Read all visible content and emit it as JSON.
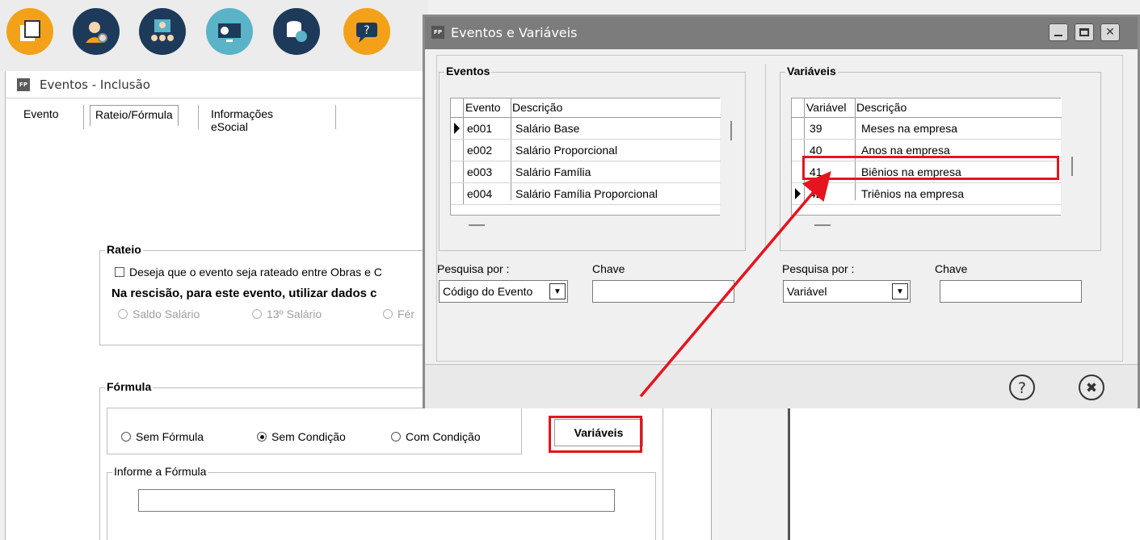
{
  "toolbar": {
    "icons": [
      {
        "name": "documents-icon",
        "color": "#f4a11a"
      },
      {
        "name": "support-gear-icon",
        "color": "#1e3a5a"
      },
      {
        "name": "users-group-icon",
        "color": "#1e3a5a"
      },
      {
        "name": "screen-transfer-icon",
        "color": "#5bb3c7"
      },
      {
        "name": "database-backup-icon",
        "color": "#1e3a5a"
      },
      {
        "name": "help-chat-icon",
        "color": "#f4a11a"
      }
    ]
  },
  "background_window": {
    "app_badge": "FP",
    "title": "Eventos - Inclusão",
    "tabs": [
      "Evento",
      "Rateio/Fórmula",
      "Informações eSocial"
    ],
    "rateio": {
      "legend": "Rateio",
      "checkbox_label": "Deseja que o evento seja rateado entre Obras e C",
      "rescisao_label": "Na rescisão, para este evento, utilizar dados c",
      "options": [
        "Saldo Salário",
        "13º Salário",
        "Fér"
      ]
    },
    "formula": {
      "legend": "Fórmula",
      "options": [
        "Sem Fórmula",
        "Sem Condição",
        "Com Condição"
      ],
      "selected": "Sem Condição",
      "variaveis_button": "Variáveis",
      "informe_legend": "Informe a Fórmula",
      "formula_value": ""
    }
  },
  "dialog": {
    "app_badge": "FP",
    "title": "Eventos e Variáveis",
    "eventos": {
      "legend": "Eventos",
      "headers": [
        "Evento",
        "Descrição"
      ],
      "rows": [
        {
          "code": "e001",
          "desc": "Salário Base"
        },
        {
          "code": "e002",
          "desc": "Salário Proporcional"
        },
        {
          "code": "e003",
          "desc": "Salário Família"
        },
        {
          "code": "e004",
          "desc": "Salário Família Proporcional"
        }
      ],
      "search_label": "Pesquisa por :",
      "search_value": "Código do Evento",
      "key_label": "Chave",
      "key_value": ""
    },
    "variaveis": {
      "legend": "Variáveis",
      "headers": [
        "Variável",
        "Descrição"
      ],
      "rows": [
        {
          "code": "39",
          "desc": "Meses na empresa"
        },
        {
          "code": "40",
          "desc": "Anos na empresa"
        },
        {
          "code": "41",
          "desc": "Biênios na empresa"
        },
        {
          "code": "42",
          "desc": "Triênios na empresa"
        }
      ],
      "search_label": "Pesquisa por :",
      "search_value": "Variável",
      "key_label": "Chave",
      "key_value": ""
    },
    "help_symbol": "?",
    "close_symbol": "✖"
  },
  "annotation_color": "#e5141e"
}
